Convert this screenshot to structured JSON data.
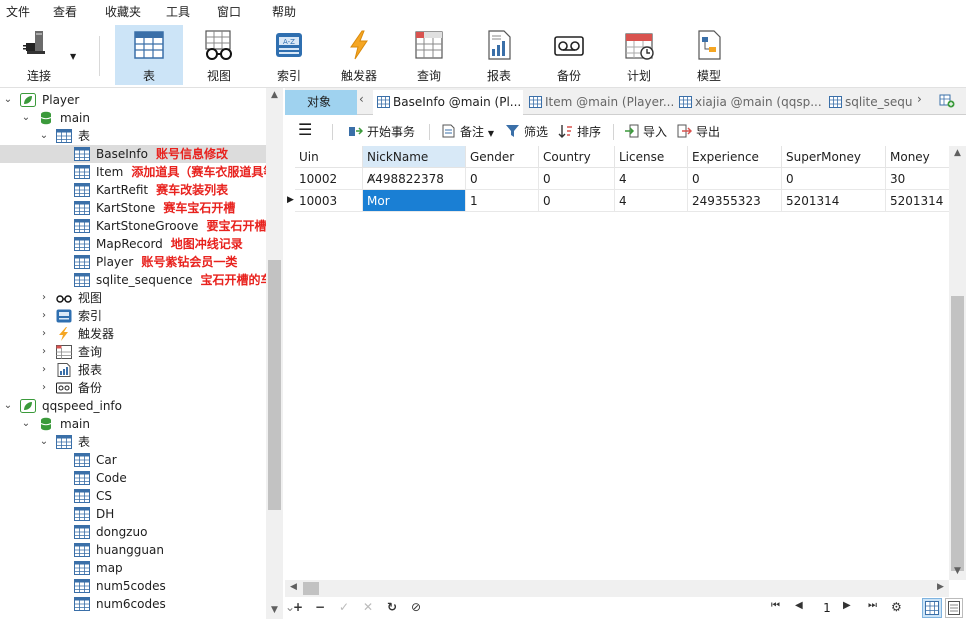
{
  "menu": [
    "文件",
    "查看",
    "收藏夹",
    "工具",
    "窗口",
    "帮助"
  ],
  "toolbar": [
    {
      "label": "连接",
      "icon": "connect-plug-icon"
    },
    {
      "label": "表",
      "icon": "table-icon",
      "active": true
    },
    {
      "label": "视图",
      "icon": "view-glasses-icon"
    },
    {
      "label": "索引",
      "icon": "index-icon"
    },
    {
      "label": "触发器",
      "icon": "trigger-bolt-icon"
    },
    {
      "label": "查询",
      "icon": "query-icon"
    },
    {
      "label": "报表",
      "icon": "report-icon"
    },
    {
      "label": "备份",
      "icon": "backup-icon"
    },
    {
      "label": "计划",
      "icon": "schedule-calendar-icon"
    },
    {
      "label": "模型",
      "icon": "model-icon"
    }
  ],
  "tree": {
    "db1": "Player",
    "db1_schema": "main",
    "tables_label": "表",
    "tables": [
      {
        "name": "BaseInfo",
        "note": "账号信息修改",
        "selected": true
      },
      {
        "name": "Item",
        "note": "添加道具（赛车衣服道具等。。。）"
      },
      {
        "name": "KartRefit",
        "note": "赛车改装列表"
      },
      {
        "name": "KartStone",
        "note": "赛车宝石开槽"
      },
      {
        "name": "KartStoneGroove",
        "note": "要宝石开槽的赛车排序号"
      },
      {
        "name": "MapRecord",
        "note": "地图冲线记录"
      },
      {
        "name": "Player",
        "note": "账号紫钻会员一类"
      },
      {
        "name": "sqlite_sequence",
        "note": "宝石开槽的车有多少"
      }
    ],
    "groups": [
      "视图",
      "索引",
      "触发器",
      "查询",
      "报表",
      "备份"
    ],
    "db2": "qqspeed_info",
    "db2_schema": "main",
    "db2_tables_label": "表",
    "db2_tables": [
      "Car",
      "Code",
      "CS",
      "DH",
      "dongzuo",
      "huangguan",
      "map",
      "num5codes",
      "num6codes"
    ]
  },
  "tabs": {
    "objects": "对象",
    "items": [
      "BaseInfo @main (Pl...",
      "Item @main (Player...",
      "xiajia @main (qqsp...",
      "sqlite_sequ"
    ]
  },
  "objbar": {
    "begin_tx": "开始事务",
    "note": "备注",
    "filter": "筛选",
    "sort": "排序",
    "import": "导入",
    "export": "导出"
  },
  "grid": {
    "columns": [
      "Uin",
      "NickName",
      "Gender",
      "Country",
      "License",
      "Experience",
      "SuperMoney",
      "Money"
    ],
    "rows": [
      [
        "10002",
        "Ⱥ498822378",
        "0",
        "0",
        "4",
        "0",
        "0",
        "30"
      ],
      [
        "10003",
        "Mor",
        "1",
        "0",
        "4",
        "249355323",
        "5201314",
        "5201314"
      ]
    ],
    "current_row": 1,
    "editing_cell": [
      1,
      1
    ]
  },
  "status": {
    "page": "1"
  },
  "colors": {
    "note_red": "#e8221e",
    "active_tab": "#9fd2ef",
    "selection": "#1a7fd4"
  }
}
